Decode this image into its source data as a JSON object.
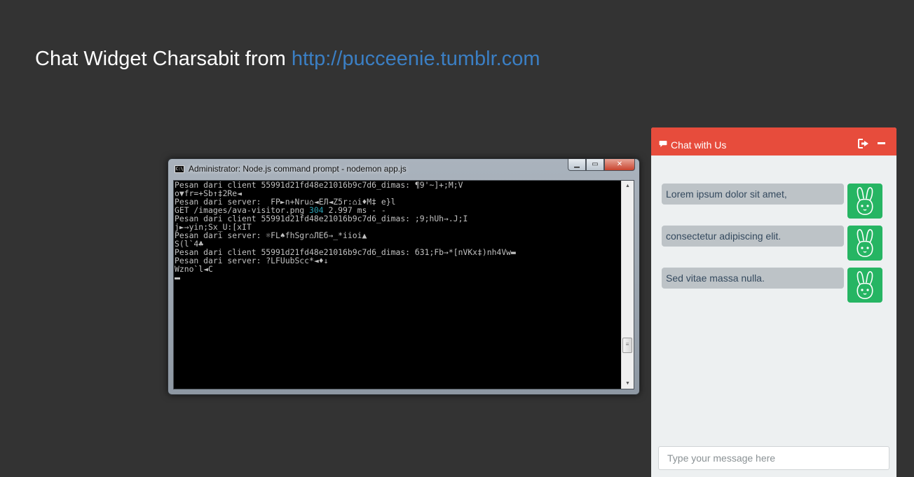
{
  "page": {
    "heading_prefix": "Chat Widget Charsabit from ",
    "heading_link": "http://pucceenie.tumblr.com",
    "link_color": "#3b7fc4",
    "background_color": "#333333"
  },
  "console_window": {
    "title": "Administrator: Node.js command prompt - nodemon  app.js",
    "icon": "console-icon",
    "controls": {
      "minimize": "minimize-icon",
      "maximize": "maximize-icon",
      "close": "close-icon"
    },
    "lines": [
      "Pesan dari client 55991d21fd48e21016b9c7d6_dimas: ¶9'~]+;M;V",
      "o▼fr=+Sb↑‡2Re◄",
      "Pesan dari server:  FP►n+Nru⌂◄EЛ◄Z5r:⌂i♦M‡ e}l",
      "GET /images/ava-visitor.png ",
      "Pesan dari client 55991d21fd48e21016b9c7d6_dimas: ;9;hUh→.J;I",
      "j►→yin;Sx_U:[xIT",
      "Pesan dari server: ☼FL♠fhSgr⌂ЛЕб→_*iioi▲",
      "S(l`4♣",
      "Pesan dari client 55991d21fd48e21016b9c7d6_dimas: б31;Fb→*[nVKx‡)nh4Vw▬",
      "Pesan dari server: ?LFUubScc*◄♦↓",
      "Wzno`l◄C"
    ],
    "get_request": {
      "path": "GET /images/ava-visitor.png ",
      "status": "304",
      "rest": " 2.997 ms - -"
    },
    "text_color": "#c0c0c0",
    "status_color": "#2aa1b3"
  },
  "chat": {
    "header_title": "Chat with Us",
    "header_color": "#e74c3c",
    "chat_icon": "comment-icon",
    "signout_icon": "sign-out-icon",
    "minimize_icon": "minimize-icon",
    "avatar_icon": "bunny-icon",
    "avatar_color": "#26b563",
    "messages": [
      {
        "text": "Lorem ipsum dolor sit amet,"
      },
      {
        "text": "consectetur adipiscing elit."
      },
      {
        "text": "Sed vitae massa nulla."
      }
    ],
    "input": {
      "placeholder": "Type your message here",
      "value": ""
    }
  }
}
